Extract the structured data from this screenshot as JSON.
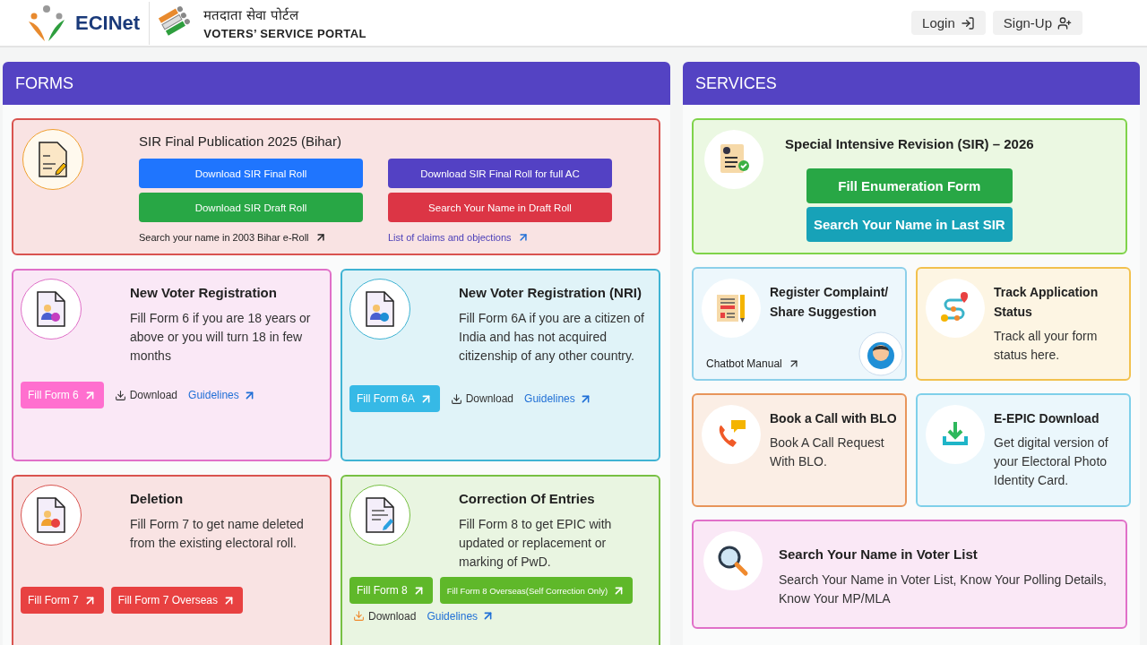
{
  "header": {
    "brand": "ECINet",
    "portal_hindi": "मतदाता सेवा पोर्टल",
    "portal_title": "VOTERS’ SERVICE PORTAL",
    "actions": [
      {
        "kind": "login",
        "label": "Login"
      },
      {
        "kind": "signup",
        "label": "Sign-Up"
      }
    ]
  },
  "forms": {
    "title": "FORMS",
    "cards": [
      {
        "kind": "sir",
        "color": "#d9534f",
        "title": "SIR Final Publication 2025 (Bihar)",
        "buttons": [
          {
            "label": "Download SIR Final Roll",
            "color": "#1f75fe"
          },
          {
            "label": "Download SIR Final Roll for full AC",
            "color": "#5341c4"
          },
          {
            "label": "Download SIR Draft Roll",
            "color": "#28a745"
          },
          {
            "label": "Search Your Name in Draft Roll",
            "color": "#dc3545"
          }
        ],
        "links": [
          {
            "label": "Search your name in 2003 Bihar e-Roll",
            "color": "#222222"
          },
          {
            "label": "List of claims and objections",
            "color": "#4b3fb8"
          }
        ]
      },
      {
        "kind": "form",
        "color": "#e070c8",
        "title": "New Voter Registration",
        "description": "Fill Form 6 if you are 18 years or above or you will turn 18 in few months",
        "actions": [
          {
            "kind": "button",
            "label": "Fill Form 6",
            "color": "#ff6fcf"
          },
          {
            "kind": "download",
            "label": "Download"
          },
          {
            "kind": "link",
            "label": "Guidelines"
          }
        ]
      },
      {
        "kind": "form",
        "color": "#3fb3d3",
        "title": "New Voter Registration (NRI)",
        "description": "Fill Form 6A if you are a citizen of India and has not acquired citizenship of any other country.",
        "actions": [
          {
            "kind": "button",
            "label": "Fill Form 6A",
            "color": "#36b9e6"
          },
          {
            "kind": "download",
            "label": "Download"
          },
          {
            "kind": "link",
            "label": "Guidelines"
          }
        ]
      },
      {
        "kind": "form",
        "color": "#d9534f",
        "title": "Deletion",
        "description": "Fill Form 7 to get name deleted from the existing electoral roll.",
        "actions": [
          {
            "kind": "button",
            "label": "Fill Form 7",
            "color": "#e84141"
          },
          {
            "kind": "button",
            "label": "Fill Form 7 Overseas",
            "color": "#e84141"
          }
        ]
      },
      {
        "kind": "form",
        "color": "#77c043",
        "title": "Correction Of Entries",
        "description": "Fill Form 8 to get EPIC with updated or replacement or marking of PwD.",
        "actions": [
          {
            "kind": "button",
            "label": "Fill Form 8",
            "color": "#5fb82a"
          },
          {
            "kind": "button",
            "label": "Fill Form 8 Overseas(Self Correction Only)",
            "color": "#5fb82a"
          },
          {
            "kind": "download",
            "label": "Download"
          },
          {
            "kind": "link",
            "label": "Guidelines"
          }
        ]
      }
    ]
  },
  "services": {
    "title": "SERVICES",
    "cards": [
      {
        "kind": "sir",
        "color": "#7fd34a",
        "title": "Special Intensive Revision (SIR) – 2026",
        "buttons": [
          {
            "label": "Fill Enumeration Form",
            "color": "#28a745"
          },
          {
            "label": "Search Your Name in Last SIR",
            "color": "#17a2b8"
          }
        ]
      },
      {
        "kind": "small",
        "color": "#8dd0ea",
        "title": "Register Complaint/ Share Suggestion",
        "link": "Chatbot Manual"
      },
      {
        "kind": "small",
        "color": "#f2c14e",
        "title": "Track Application Status",
        "description": "Track all your form status here."
      },
      {
        "kind": "small",
        "color": "#e8955a",
        "title": "Book a Call with BLO",
        "description": "Book A Call Request With BLO."
      },
      {
        "kind": "small",
        "color": "#7fd0ea",
        "title": "E-EPIC Download",
        "description": "Get digital version of your Electoral Photo Identity Card."
      },
      {
        "kind": "wide",
        "color": "#e070c8",
        "title": "Search Your Name in Voter List",
        "description": "Search Your Name in Voter List, Know Your Polling Details, Know Your MP/MLA"
      }
    ]
  }
}
